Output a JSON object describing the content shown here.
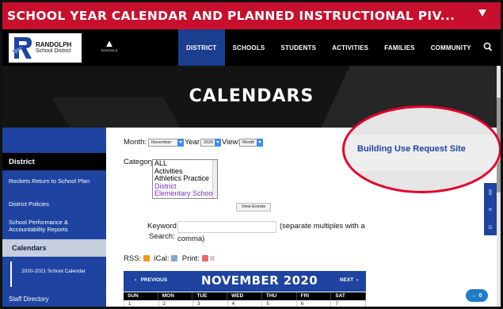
{
  "announcement": {
    "text": "SCHOOL YEAR CALENDAR AND PLANNED INSTRUCTIONAL PIV..."
  },
  "logo": {
    "line1": "RANDOLPH",
    "line2": "School District"
  },
  "schools_icon_label": "SCHOOLS",
  "nav": [
    "DISTRICT",
    "SCHOOLS",
    "STUDENTS",
    "ACTIVITIES",
    "FAMILIES",
    "COMMUNITY"
  ],
  "hero_title": "CALENDARS",
  "sidebar": {
    "heading": "District",
    "items": [
      "Rockets Return to School Plan",
      "District Policies",
      "School Performance & Accountability Reports"
    ],
    "active": "Calendars",
    "sub_item": "2020-2021 School Calendar",
    "bottom": "Staff Directory"
  },
  "filters": {
    "month_label": "Month:",
    "month_value": "November",
    "year_label": "Year:",
    "year_value": "2020",
    "view_label": "View:",
    "view_value": "Month",
    "category_label": "Category:",
    "categories": [
      "ALL",
      "Activities",
      "Athletics Practice",
      "District",
      "Elementary School"
    ],
    "view_events_button": "View Events",
    "keyword_label": "Keyword",
    "search_label": "Search:",
    "keyword_hint": "(separate multiples with a",
    "keyword_hint2": "comma)"
  },
  "feeds": {
    "rss": "RSS:",
    "ical": "iCal:",
    "print": "Print:"
  },
  "calendar": {
    "prev": "PREVIOUS",
    "title": "NOVEMBER 2020",
    "next": "NEXT",
    "days": [
      "SUN",
      "MON",
      "TUE",
      "WED",
      "THU",
      "FRI",
      "SAT"
    ],
    "dates": [
      "1",
      "2",
      "3",
      "4",
      "5",
      "6",
      "7"
    ]
  },
  "callout": {
    "link": "Building Use Request Site"
  },
  "fab_label": "0",
  "colors": {
    "brand_red": "#c8102e",
    "brand_blue": "#1e43a0",
    "callout_ring": "#e4002b"
  }
}
